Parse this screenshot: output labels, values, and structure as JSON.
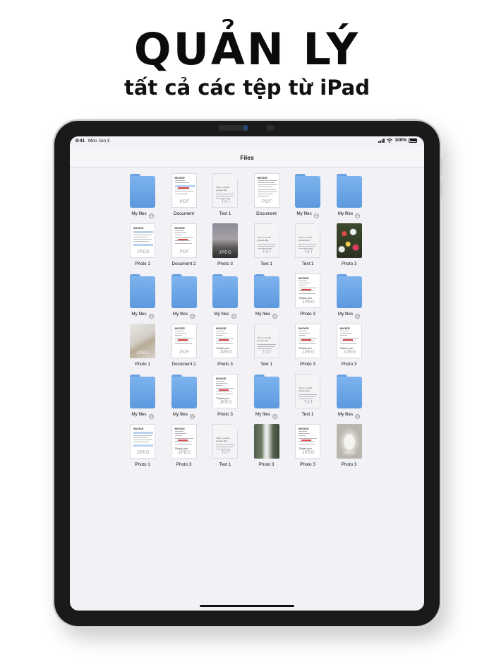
{
  "promo": {
    "headline": "QUẢN LÝ",
    "subline": "tất cả các tệp từ iPad"
  },
  "status_bar": {
    "time": "9:41",
    "date": "Mon Jun 3",
    "battery": "100%"
  },
  "navbar": {
    "title": "Files"
  },
  "files": [
    {
      "label": "My files",
      "kind": "folder",
      "more": true
    },
    {
      "label": "Document",
      "kind": "pdf",
      "tag": "PDF"
    },
    {
      "label": "Text 1",
      "kind": "txt",
      "tag": "TXT"
    },
    {
      "label": "Document",
      "kind": "pdf2",
      "tag": "PDF"
    },
    {
      "label": "My files",
      "kind": "folder",
      "more": true
    },
    {
      "label": "My files",
      "kind": "folder",
      "more": true
    },
    {
      "label": "Photo 1",
      "kind": "invoice",
      "tag": "JPEG"
    },
    {
      "label": "Document 2",
      "kind": "invoicepdf",
      "tag": "PDF"
    },
    {
      "label": "Photo 3",
      "kind": "photo-dusk",
      "tag": "JPEG"
    },
    {
      "label": "Text 1",
      "kind": "txt",
      "tag": "TXT"
    },
    {
      "label": "Text 1",
      "kind": "txt",
      "tag": "TXT"
    },
    {
      "label": "Photo 3",
      "kind": "photo-flowers",
      "tag": ""
    },
    {
      "label": "My files",
      "kind": "folder",
      "more": true
    },
    {
      "label": "My files",
      "kind": "folder",
      "more": true
    },
    {
      "label": "My files",
      "kind": "folder",
      "more": true
    },
    {
      "label": "My files",
      "kind": "folder",
      "more": true
    },
    {
      "label": "Photo 3",
      "kind": "invoice2",
      "tag": "JPEG"
    },
    {
      "label": "My files",
      "kind": "folder",
      "more": true
    },
    {
      "label": "Photo 1",
      "kind": "photo-laptop",
      "tag": "JPEG"
    },
    {
      "label": "Document 2",
      "kind": "invoicepdf",
      "tag": "PDF"
    },
    {
      "label": "Photo 3",
      "kind": "invoice2",
      "tag": "JPEG"
    },
    {
      "label": "Text 1",
      "kind": "txt",
      "tag": "TXT"
    },
    {
      "label": "Photo 3",
      "kind": "invoice2",
      "tag": "JPEG"
    },
    {
      "label": "Photo 3",
      "kind": "invoice2",
      "tag": "JPEG"
    },
    {
      "label": "My files",
      "kind": "folder",
      "more": true
    },
    {
      "label": "My files",
      "kind": "folder",
      "more": true
    },
    {
      "label": "Photo 3",
      "kind": "invoice2",
      "tag": "JPEG"
    },
    {
      "label": "My files",
      "kind": "folder",
      "more": true
    },
    {
      "label": "Text 1",
      "kind": "txt",
      "tag": "TXT"
    },
    {
      "label": "My files",
      "kind": "folder",
      "more": true
    },
    {
      "label": "Photo 1",
      "kind": "invoice",
      "tag": "JPEG"
    },
    {
      "label": "Photo 3",
      "kind": "invoice2",
      "tag": "JPEG"
    },
    {
      "label": "Text 1",
      "kind": "txt",
      "tag": "TXT"
    },
    {
      "label": "Photo 3",
      "kind": "photo-falls",
      "tag": ""
    },
    {
      "label": "Photo 3",
      "kind": "invoice2",
      "tag": "JPEG"
    },
    {
      "label": "Photo 3",
      "kind": "photo-stone",
      "tag": "JPEG"
    }
  ],
  "doc_texts": {
    "invoice_head": "INVOICE",
    "txt_body": "This is, our file preview title",
    "signature": "Thank you"
  },
  "icons": {
    "folder": "folder-icon",
    "more": "more-options-icon",
    "wifi": "wifi-icon",
    "signal": "cellular-signal-icon",
    "battery": "battery-icon"
  },
  "colors": {
    "folder": "#6ba5e6",
    "screen_bg": "#f2f1f6",
    "bezel": "#1a1a1a"
  }
}
